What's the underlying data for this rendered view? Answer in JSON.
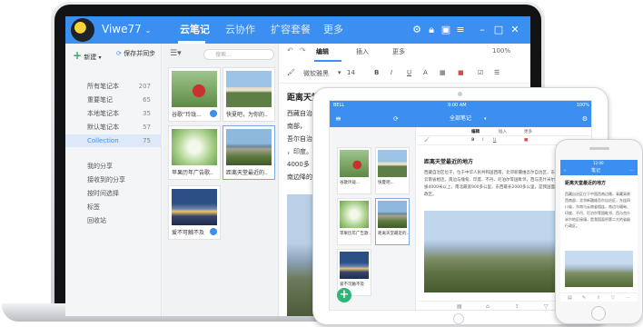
{
  "laptop": {
    "user": "Viwe77",
    "nav_tabs": [
      {
        "label": "云笔记",
        "active": true
      },
      {
        "label": "云协作",
        "active": false
      },
      {
        "label": "扩容套餐",
        "active": false
      },
      {
        "label": "更多",
        "active": false
      }
    ],
    "new_label": "新建",
    "sync_label": "保存并同步",
    "search_placeholder": "搜索...",
    "sidebar": [
      {
        "label": "所有笔记本",
        "count": "207"
      },
      {
        "label": "重要笔记",
        "count": "65"
      },
      {
        "label": "本地笔记本",
        "count": "35"
      },
      {
        "label": "默认笔记本",
        "count": "57"
      },
      {
        "label": "Collection",
        "count": "75"
      }
    ],
    "sidebar_secondary": [
      "我的分享",
      "接收到的分享",
      "按时间选择",
      "标签",
      "回收站"
    ],
    "note_cards": [
      {
        "caption": "谷歌“玲珑..."
      },
      {
        "caption": "快夏吧，为你的..."
      },
      {
        "caption": "苹果历年广告歌..."
      },
      {
        "caption": "距离天堂最近的..."
      },
      {
        "caption": "爱不可触不及"
      }
    ],
    "editor_tabs": [
      "编辑",
      "插入",
      "更多"
    ],
    "zoom": "100%",
    "font_name": "微软雅黑",
    "font_size": "14",
    "note_title": "距离天堂最近的地方",
    "note_body_lines": [
      "西藏自治",
      "南部，",
      "吾尔自治",
      "，印度。",
      "4000多",
      "南边降的"
    ]
  },
  "tablet": {
    "carrier": "BELL",
    "time": "9:00 AM",
    "battery": "100%",
    "header_title": "全部笔记",
    "note_cards": [
      {
        "caption": "谷歌玲珑..."
      },
      {
        "caption": "快夏吧..."
      },
      {
        "caption": "苹果历年广告歌..."
      },
      {
        "caption": "距离天堂最近的..."
      },
      {
        "caption": "爱不可触不及"
      }
    ],
    "editor_tabs": [
      "编辑",
      "插入",
      "更多"
    ],
    "note_title": "距离天堂最近的地方",
    "note_body": "西藏自治区位于，位于中华人民共和国西南，北邻新疆维吾尔自治区，东连四川省，东南与云南省相连，南边与缅甸、印度、不丹、尼泊尔等国毗邻，西与克什米尔地区接壤。平均海拔4000米以上，南北最宽900多公里，东西最长2000多公里，是我国面积第二大的省级行政区。"
  },
  "phone": {
    "status_text": "12:00",
    "header_title": "笔记",
    "note_title": "距离天堂最近的地方",
    "note_body": "西藏自治区位于中国西南边陲，青藏高原西南部，北邻新疆维吾尔自治区，东连四川省，东南与云南省相连，南边与缅甸、印度、不丹、尼泊尔等国毗邻，西与克什米尔地区接壤，是我国面积第二大的省级行政区。"
  },
  "colors": {
    "accent": "#3a8ff0",
    "fab": "#2bb673",
    "selection": "#dde9f8"
  }
}
